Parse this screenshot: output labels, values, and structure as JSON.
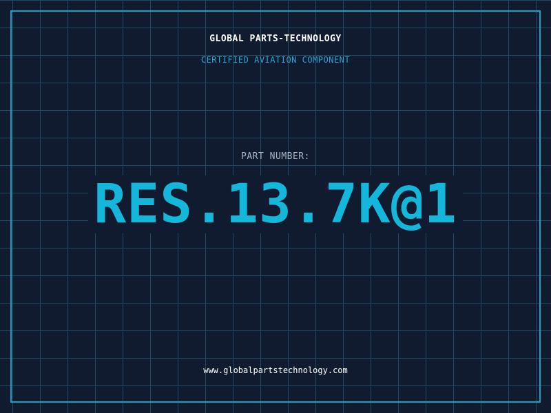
{
  "header": {
    "company": "GLOBAL PARTS-TECHNOLOGY",
    "tagline": "CERTIFIED AVIATION COMPONENT"
  },
  "part": {
    "label": "PART NUMBER:",
    "number": "RES.13.7K@1"
  },
  "footer": {
    "website": "www.globalpartstechnology.com"
  },
  "colors": {
    "background": "#111b30",
    "grid": "#1f4a66",
    "accent": "#14b6da",
    "frame": "#1a9fc4"
  }
}
